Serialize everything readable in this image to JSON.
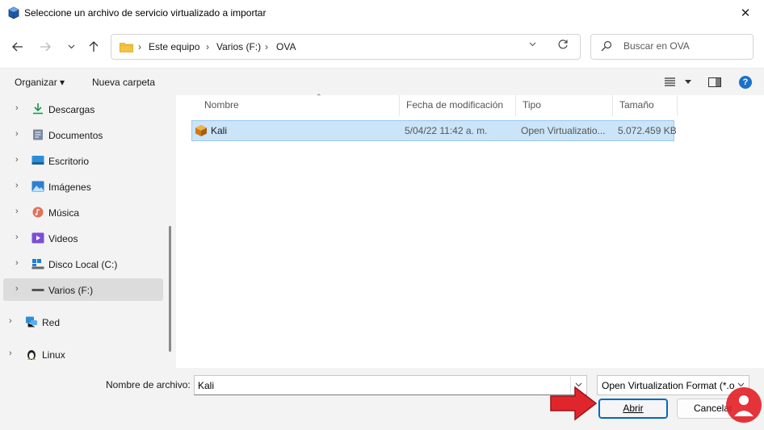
{
  "window": {
    "title": "Seleccione un archivo de servicio virtualizado a importar",
    "close_label": "✕"
  },
  "address": {
    "crumbs": [
      "Este equipo",
      "Varios (F:)",
      "OVA"
    ],
    "separator": "›"
  },
  "search": {
    "placeholder": "Buscar en OVA"
  },
  "toolbar": {
    "organize_label": "Organizar ▾",
    "new_folder_label": "Nueva carpeta",
    "help_label": "?"
  },
  "sidebar": {
    "items": [
      {
        "label": "Descargas",
        "icon": "download-icon"
      },
      {
        "label": "Documentos",
        "icon": "documents-icon"
      },
      {
        "label": "Escritorio",
        "icon": "desktop-icon"
      },
      {
        "label": "Imágenes",
        "icon": "pictures-icon"
      },
      {
        "label": "Música",
        "icon": "music-icon"
      },
      {
        "label": "Videos",
        "icon": "videos-icon"
      },
      {
        "label": "Disco Local (C:)",
        "icon": "drive-c-icon"
      },
      {
        "label": "Varios (F:)",
        "icon": "drive-f-icon",
        "selected": true
      },
      {
        "label": "Red",
        "icon": "network-icon"
      },
      {
        "label": "Linux",
        "icon": "linux-icon"
      }
    ]
  },
  "files": {
    "columns": [
      "Nombre",
      "Fecha de modificación",
      "Tipo",
      "Tamaño"
    ],
    "rows": [
      {
        "name": "Kali",
        "modified": "5/04/22 11:42 a. m.",
        "type": "Open Virtualizatio...",
        "size": "5.072.459 KB",
        "icon": "ova-package-icon"
      }
    ]
  },
  "footer": {
    "filename_label": "Nombre de archivo:",
    "filename_value": "Kali",
    "filetype_value": "Open Virtualization Format (*.o",
    "open_label": "Abrir",
    "cancel_label": "Cancelar"
  },
  "colors": {
    "accent": "#0067c0",
    "selection": "#cce4f7",
    "arrow": "#e0262c"
  }
}
